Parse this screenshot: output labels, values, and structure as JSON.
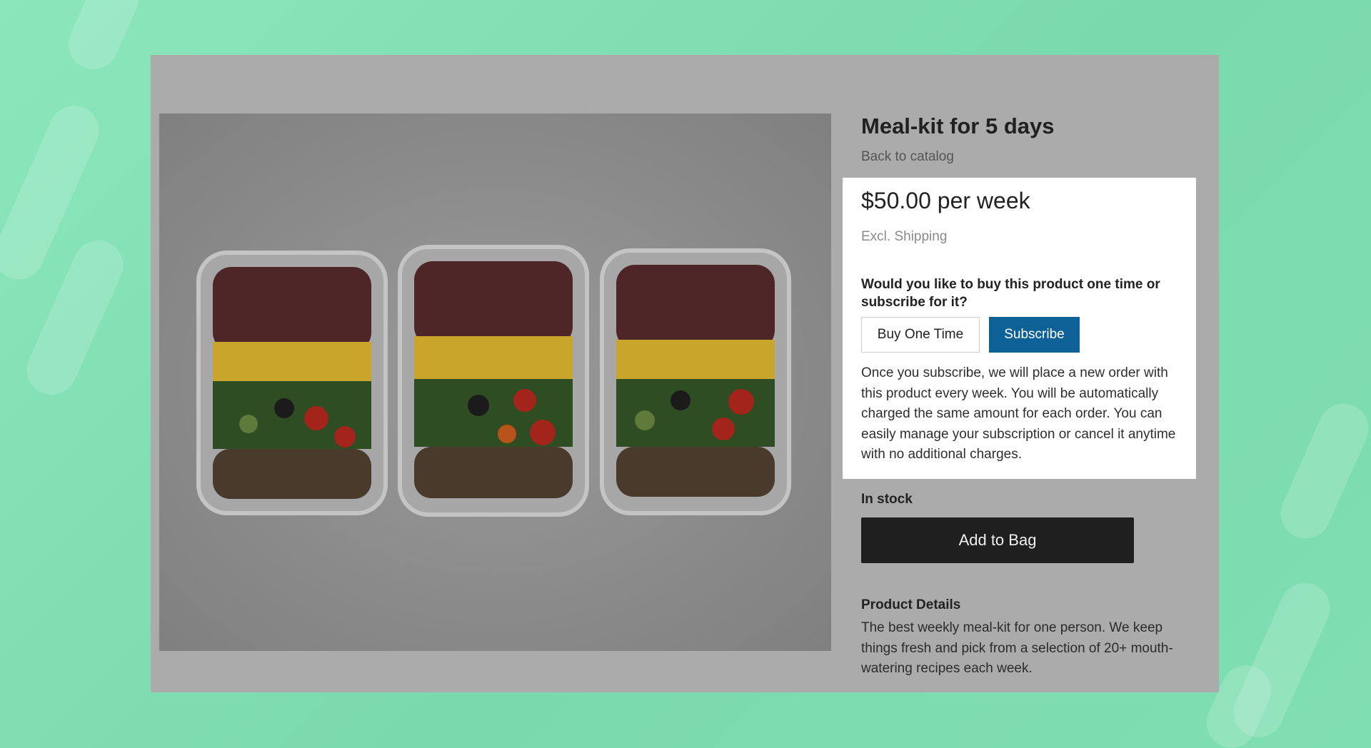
{
  "product": {
    "title": "Meal-kit for 5 days",
    "back_link": "Back to catalog"
  },
  "purchase": {
    "price": "$50.00 per week",
    "shipping_note": "Excl. Shipping",
    "question": "Would you like to buy this product one time or subscribe for it?",
    "buy_once_label": "Buy One Time",
    "subscribe_label": "Subscribe",
    "subscribe_explainer": "Once you subscribe, we will place a new order with this product every week. You will be automatically charged the same amount for each order. You can easily manage your subscription or cancel it anytime with no additional charges."
  },
  "stock_status": "In stock",
  "add_to_bag_label": "Add to Bag",
  "details": {
    "heading": "Product Details",
    "text": "The best weekly meal-kit for one person. We keep things fresh and pick from a selection of 20+ mouth-watering recipes each week."
  },
  "colors": {
    "subscribe_button": "#0e6196",
    "add_to_bag_button": "#1f1f1f",
    "page_background": "#86e2b6",
    "overlay_panel": "#ababab"
  }
}
